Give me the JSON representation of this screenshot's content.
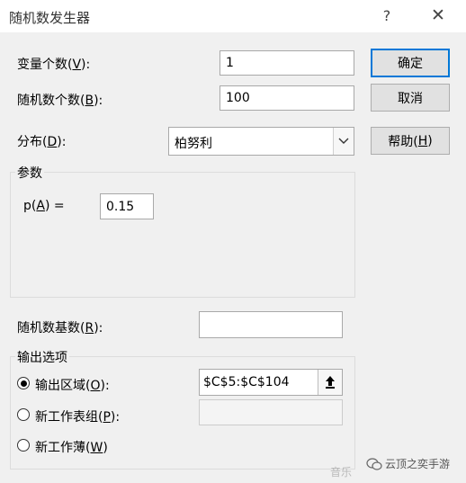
{
  "window": {
    "title": "随机数发生器",
    "help_glyph": "?",
    "close_glyph": "✕"
  },
  "fields": {
    "variables": {
      "label_pre": "变量个数(",
      "label_key": "V",
      "label_post": "):",
      "value": "1"
    },
    "count": {
      "label_pre": "随机数个数(",
      "label_key": "B",
      "label_post": "):",
      "value": "100"
    },
    "distribution": {
      "label_pre": "分布(",
      "label_key": "D",
      "label_post": "):",
      "value": "柏努利"
    }
  },
  "buttons": {
    "ok": "确定",
    "cancel": "取消",
    "help_pre": "帮助(",
    "help_key": "H",
    "help_post": ")"
  },
  "params": {
    "group_title": "参数",
    "p_label_pre": "p(",
    "p_label_key": "A",
    "p_label_post": ") =",
    "p_value": "0.15"
  },
  "seed": {
    "label_pre": "随机数基数(",
    "label_key": "R",
    "label_post": "):",
    "value": ""
  },
  "output": {
    "group_title": "输出选项",
    "options": [
      {
        "label_pre": "输出区域(",
        "label_key": "O",
        "label_post": "):",
        "selected": true,
        "value": "$C$5:$C$104"
      },
      {
        "label_pre": "新工作表组(",
        "label_key": "P",
        "label_post": "):",
        "selected": false,
        "value": ""
      },
      {
        "label_pre": "新工作薄(",
        "label_key": "W",
        "label_post": ")",
        "selected": false
      }
    ]
  },
  "watermark": {
    "text": "云顶之奕手游",
    "faint": "音乐"
  },
  "colors": {
    "default_button_border": "#0078d7",
    "dialog_bg": "#f0f0f0"
  }
}
